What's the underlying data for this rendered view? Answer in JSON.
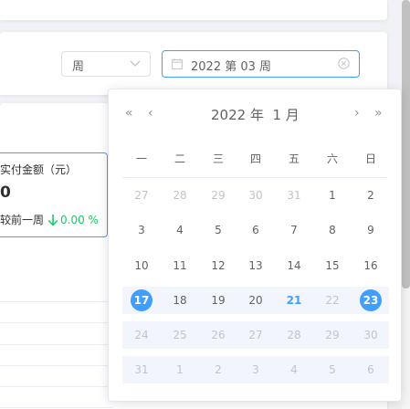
{
  "filter": {
    "period_select": "周",
    "date_value": "2022 第 03 周"
  },
  "stat": {
    "title": "实付金额（元）",
    "value": "0",
    "compare_label": "较前一周",
    "compare_pct": "0.00 %"
  },
  "picker": {
    "prev_year": "«",
    "prev_month": "‹",
    "next_month": "›",
    "next_year": "»",
    "year_label": "2022 年",
    "month_label": "1 月",
    "weekdays": [
      "一",
      "二",
      "三",
      "四",
      "五",
      "六",
      "日"
    ],
    "rows": [
      [
        "27",
        "28",
        "29",
        "30",
        "31",
        "1",
        "2"
      ],
      [
        "3",
        "4",
        "5",
        "6",
        "7",
        "8",
        "9"
      ],
      [
        "10",
        "11",
        "12",
        "13",
        "14",
        "15",
        "16"
      ],
      [
        "17",
        "18",
        "19",
        "20",
        "21",
        "22",
        "23"
      ],
      [
        "24",
        "25",
        "26",
        "27",
        "28",
        "29",
        "30"
      ],
      [
        "31",
        "1",
        "2",
        "3",
        "4",
        "5",
        "6"
      ]
    ]
  },
  "colors": {
    "accent": "#409eff",
    "down": "#13ce66"
  }
}
